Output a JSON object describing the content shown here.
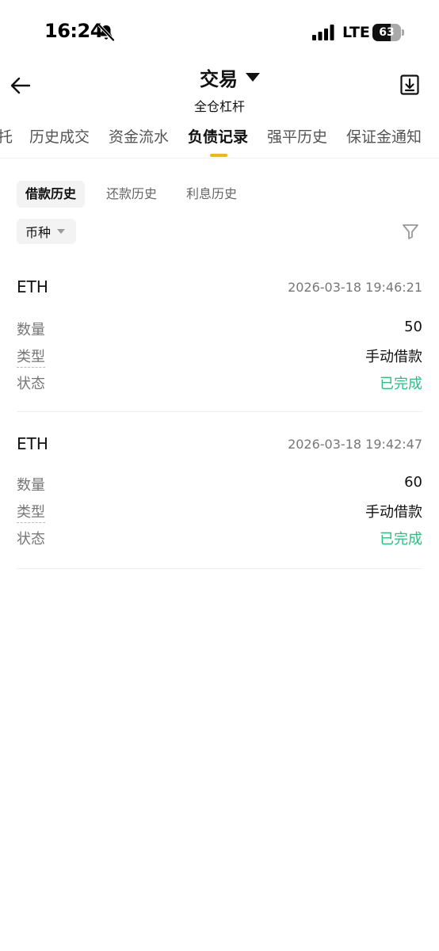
{
  "status_bar": {
    "time": "16:24",
    "network": "LTE",
    "battery_level": "63",
    "battery_fraction": 0.63
  },
  "header": {
    "title": "交易",
    "subtitle": "全仓杠杆"
  },
  "tabs": [
    {
      "label": "托",
      "active": false
    },
    {
      "label": "历史成交",
      "active": false
    },
    {
      "label": "资金流水",
      "active": false
    },
    {
      "label": "负债记录",
      "active": true
    },
    {
      "label": "强平历史",
      "active": false
    },
    {
      "label": "保证金通知",
      "active": false
    }
  ],
  "subtabs": [
    {
      "label": "借款历史",
      "active": true
    },
    {
      "label": "还款历史",
      "active": false
    },
    {
      "label": "利息历史",
      "active": false
    }
  ],
  "filter": {
    "currency_label": "币种"
  },
  "labels": {
    "amount": "数量",
    "type": "类型",
    "status": "状态"
  },
  "records": [
    {
      "coin": "ETH",
      "time": "2026-03-18 19:46:21",
      "amount": "50",
      "type": "手动借款",
      "status": "已完成"
    },
    {
      "coin": "ETH",
      "time": "2026-03-18 19:42:47",
      "amount": "60",
      "type": "手动借款",
      "status": "已完成"
    }
  ],
  "colors": {
    "accent": "#f0b90b",
    "status_done": "#2ebd85"
  }
}
